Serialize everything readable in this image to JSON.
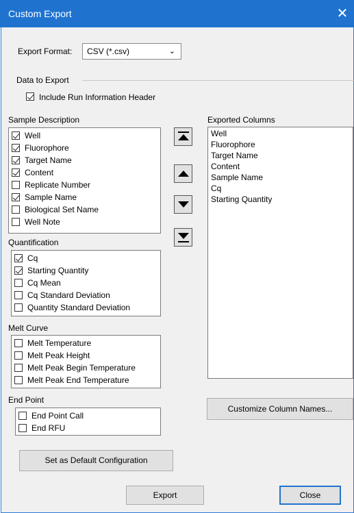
{
  "window": {
    "title": "Custom Export",
    "close_glyph": "✕"
  },
  "export_format": {
    "label": "Export Format:",
    "value": "CSV (*.csv)"
  },
  "data_to_export": {
    "label": "Data to Export",
    "include_header": {
      "label": "Include Run Information Header",
      "checked": true
    }
  },
  "sample_description": {
    "label": "Sample Description",
    "items": [
      {
        "label": "Well",
        "checked": true
      },
      {
        "label": "Fluorophore",
        "checked": true
      },
      {
        "label": "Target Name",
        "checked": true
      },
      {
        "label": "Content",
        "checked": true
      },
      {
        "label": "Replicate Number",
        "checked": false
      },
      {
        "label": "Sample Name",
        "checked": true
      },
      {
        "label": "Biological Set Name",
        "checked": false
      },
      {
        "label": "Well Note",
        "checked": false
      }
    ]
  },
  "quantification": {
    "label": "Quantification",
    "items": [
      {
        "label": "Cq",
        "checked": true
      },
      {
        "label": "Starting Quantity",
        "checked": true
      },
      {
        "label": "Cq Mean",
        "checked": false
      },
      {
        "label": "Cq Standard Deviation",
        "checked": false
      },
      {
        "label": "Quantity Standard Deviation",
        "checked": false
      }
    ]
  },
  "melt_curve": {
    "label": "Melt Curve",
    "items": [
      {
        "label": "Melt Temperature",
        "checked": false
      },
      {
        "label": "Melt Peak Height",
        "checked": false
      },
      {
        "label": "Melt Peak Begin Temperature",
        "checked": false
      },
      {
        "label": "Melt Peak End Temperature",
        "checked": false
      }
    ]
  },
  "end_point": {
    "label": "End Point",
    "items": [
      {
        "label": "End Point Call",
        "checked": false
      },
      {
        "label": "End RFU",
        "checked": false
      }
    ]
  },
  "exported_columns": {
    "label": "Exported Columns",
    "items": [
      "Well",
      "Fluorophore",
      "Target Name",
      "Content",
      "Sample Name",
      "Cq",
      "Starting Quantity"
    ]
  },
  "buttons": {
    "customize": "Customize Column Names...",
    "set_default": "Set as Default Configuration",
    "export": "Export",
    "close": "Close"
  },
  "colors": {
    "titlebar": "#1f73cf",
    "background": "#f0f0f0",
    "primary_border": "#1f73cf"
  }
}
